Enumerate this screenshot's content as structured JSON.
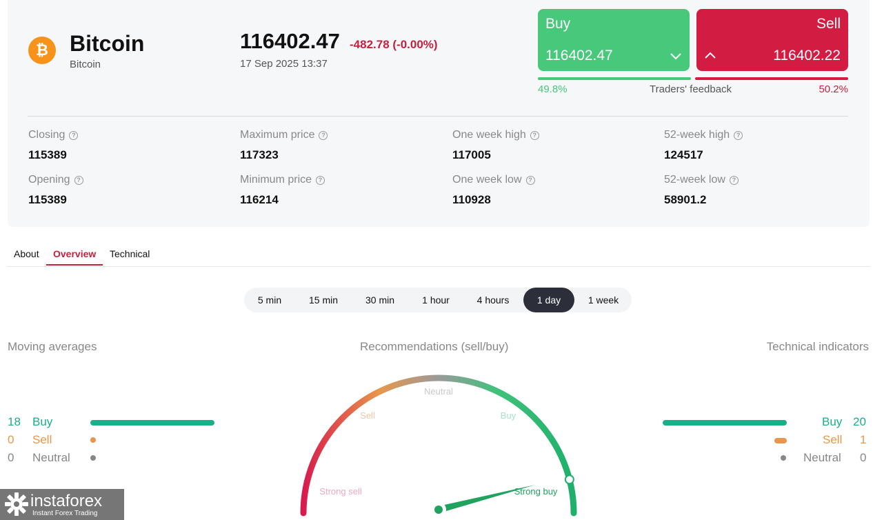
{
  "asset": {
    "logo_symbol": "₿",
    "name": "Bitcoin",
    "subtitle": "Bitcoin",
    "price": "116402.47",
    "change": "-482.78 (-0.00%)",
    "datetime": "17 Sep 2025 13:37"
  },
  "trade": {
    "buy_label": "Buy",
    "buy_price": "116402.47",
    "sell_label": "Sell",
    "sell_price": "116402.22",
    "buy_pct": "49.8%",
    "feedback_label": "Traders' feedback",
    "sell_pct": "50.2%",
    "colors": {
      "buy": "#47c87a",
      "sell": "#d31c41"
    }
  },
  "stats": [
    {
      "label": "Closing",
      "value": "115389"
    },
    {
      "label": "Maximum price",
      "value": "117323"
    },
    {
      "label": "One week high",
      "value": "117005"
    },
    {
      "label": "52-week high",
      "value": "124517"
    },
    {
      "label": "Opening",
      "value": "115389"
    },
    {
      "label": "Minimum price",
      "value": "116214"
    },
    {
      "label": "One week low",
      "value": "110928"
    },
    {
      "label": "52-week low",
      "value": "58901.2"
    }
  ],
  "tabs": [
    {
      "label": "About",
      "active": false
    },
    {
      "label": "Overview",
      "active": true
    },
    {
      "label": "Technical",
      "active": false
    }
  ],
  "periods": [
    {
      "label": "5 min",
      "active": false
    },
    {
      "label": "15 min",
      "active": false
    },
    {
      "label": "30 min",
      "active": false
    },
    {
      "label": "1 hour",
      "active": false
    },
    {
      "label": "4 hours",
      "active": false
    },
    {
      "label": "1 day",
      "active": true
    },
    {
      "label": "1 week",
      "active": false
    }
  ],
  "moving_averages": {
    "title": "Moving averages",
    "buy": {
      "count": "18",
      "label": "Buy"
    },
    "sell": {
      "count": "0",
      "label": "Sell"
    },
    "neutral": {
      "count": "0",
      "label": "Neutral"
    }
  },
  "recommendations": {
    "title": "Recommendations (sell/buy)",
    "labels": {
      "neutral": "Neutral",
      "sell": "Sell",
      "buy": "Buy",
      "strong_sell": "Strong sell",
      "strong_buy": "Strong buy"
    },
    "needle_value": 0.92
  },
  "technical_indicators": {
    "title": "Technical indicators",
    "buy": {
      "count": "20",
      "label": "Buy"
    },
    "sell": {
      "count": "1",
      "label": "Sell"
    },
    "neutral": {
      "count": "0",
      "label": "Neutral"
    }
  },
  "colors": {
    "buy": "#1aae8a",
    "sell": "#e8974a",
    "neutral": "#888888",
    "accent": "#c4213e"
  },
  "brand": {
    "name": "instaforex",
    "tagline": "Instant Forex Trading"
  }
}
